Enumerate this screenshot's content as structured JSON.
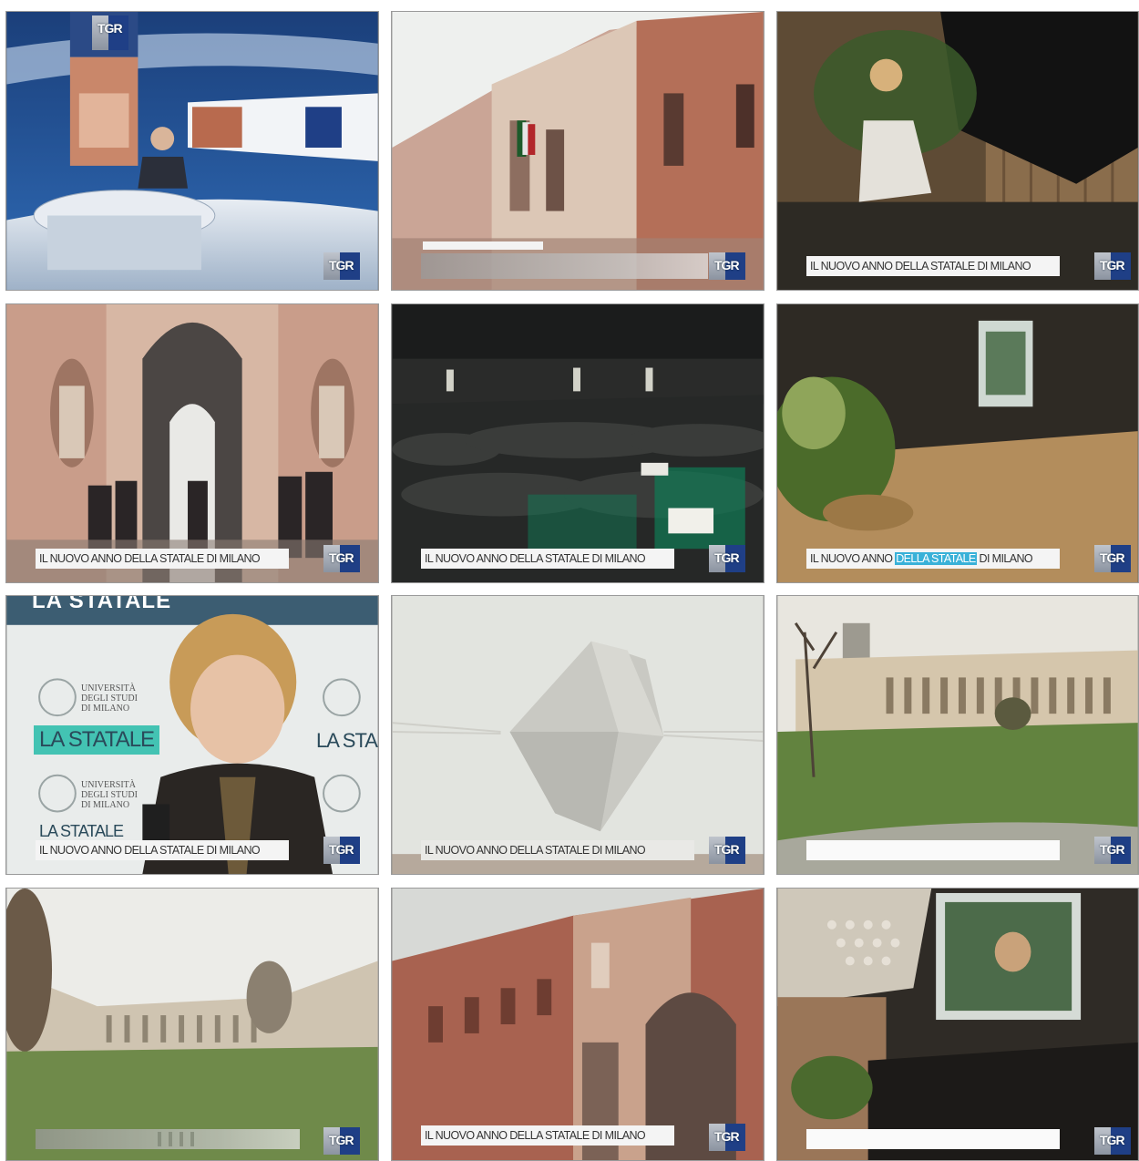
{
  "grid": {
    "frames": [
      {
        "id": "f1",
        "scene": "news-studio",
        "caption": null,
        "bug": "TGR",
        "studio_logo": "TGR"
      },
      {
        "id": "f2",
        "scene": "palazzo-facade-flags",
        "caption": "",
        "bug": "TGR"
      },
      {
        "id": "f3",
        "scene": "pianist-grand-piano",
        "caption": "IL NUOVO ANNO DELLA STATALE DI MILANO",
        "bug": "TGR"
      },
      {
        "id": "f4",
        "scene": "arcade-entrance",
        "caption": "IL NUOVO ANNO DELLA STATALE DI MILANO",
        "bug": "TGR"
      },
      {
        "id": "f5",
        "scene": "auditorium-audience",
        "caption": "IL NUOVO ANNO DELLA STATALE DI MILANO",
        "bug": "TGR"
      },
      {
        "id": "f6",
        "scene": "stage-screen-plants",
        "caption": "IL NUOVO ANNO DELLA STATALE DI MILANO",
        "caption_parts": [
          "IL NUOVO ANNO ",
          "DELLA STATALE",
          " DI MILANO"
        ],
        "bug": "TGR"
      },
      {
        "id": "f7",
        "scene": "rector-interview",
        "caption": "IL NUOVO ANNO DELLA STATALE DI MILANO",
        "bug": "TGR",
        "backdrop": {
          "top": "LA STATALE",
          "univ_lines": [
            "UNIVERSITÀ",
            "DEGLI STUDI",
            "DI MILANO"
          ],
          "brand": "LA STATALE",
          "brand_right": "LA STA",
          "bottom": "LA STATALE"
        }
      },
      {
        "id": "f8",
        "scene": "paper-sculpture-sky",
        "caption": "IL NUOVO ANNO DELLA STATALE DI MILANO",
        "bug": "TGR"
      },
      {
        "id": "f9",
        "scene": "courtyard-wide",
        "caption": "",
        "bug": "TGR"
      },
      {
        "id": "f10",
        "scene": "courtyard-lawn",
        "caption": "",
        "bug": "TGR"
      },
      {
        "id": "f11",
        "scene": "brick-facade",
        "caption": "IL NUOVO ANNO DELLA STATALE DI MILANO",
        "bug": "TGR"
      },
      {
        "id": "f12",
        "scene": "hall-projection",
        "caption": "",
        "bug": "TGR"
      }
    ]
  }
}
